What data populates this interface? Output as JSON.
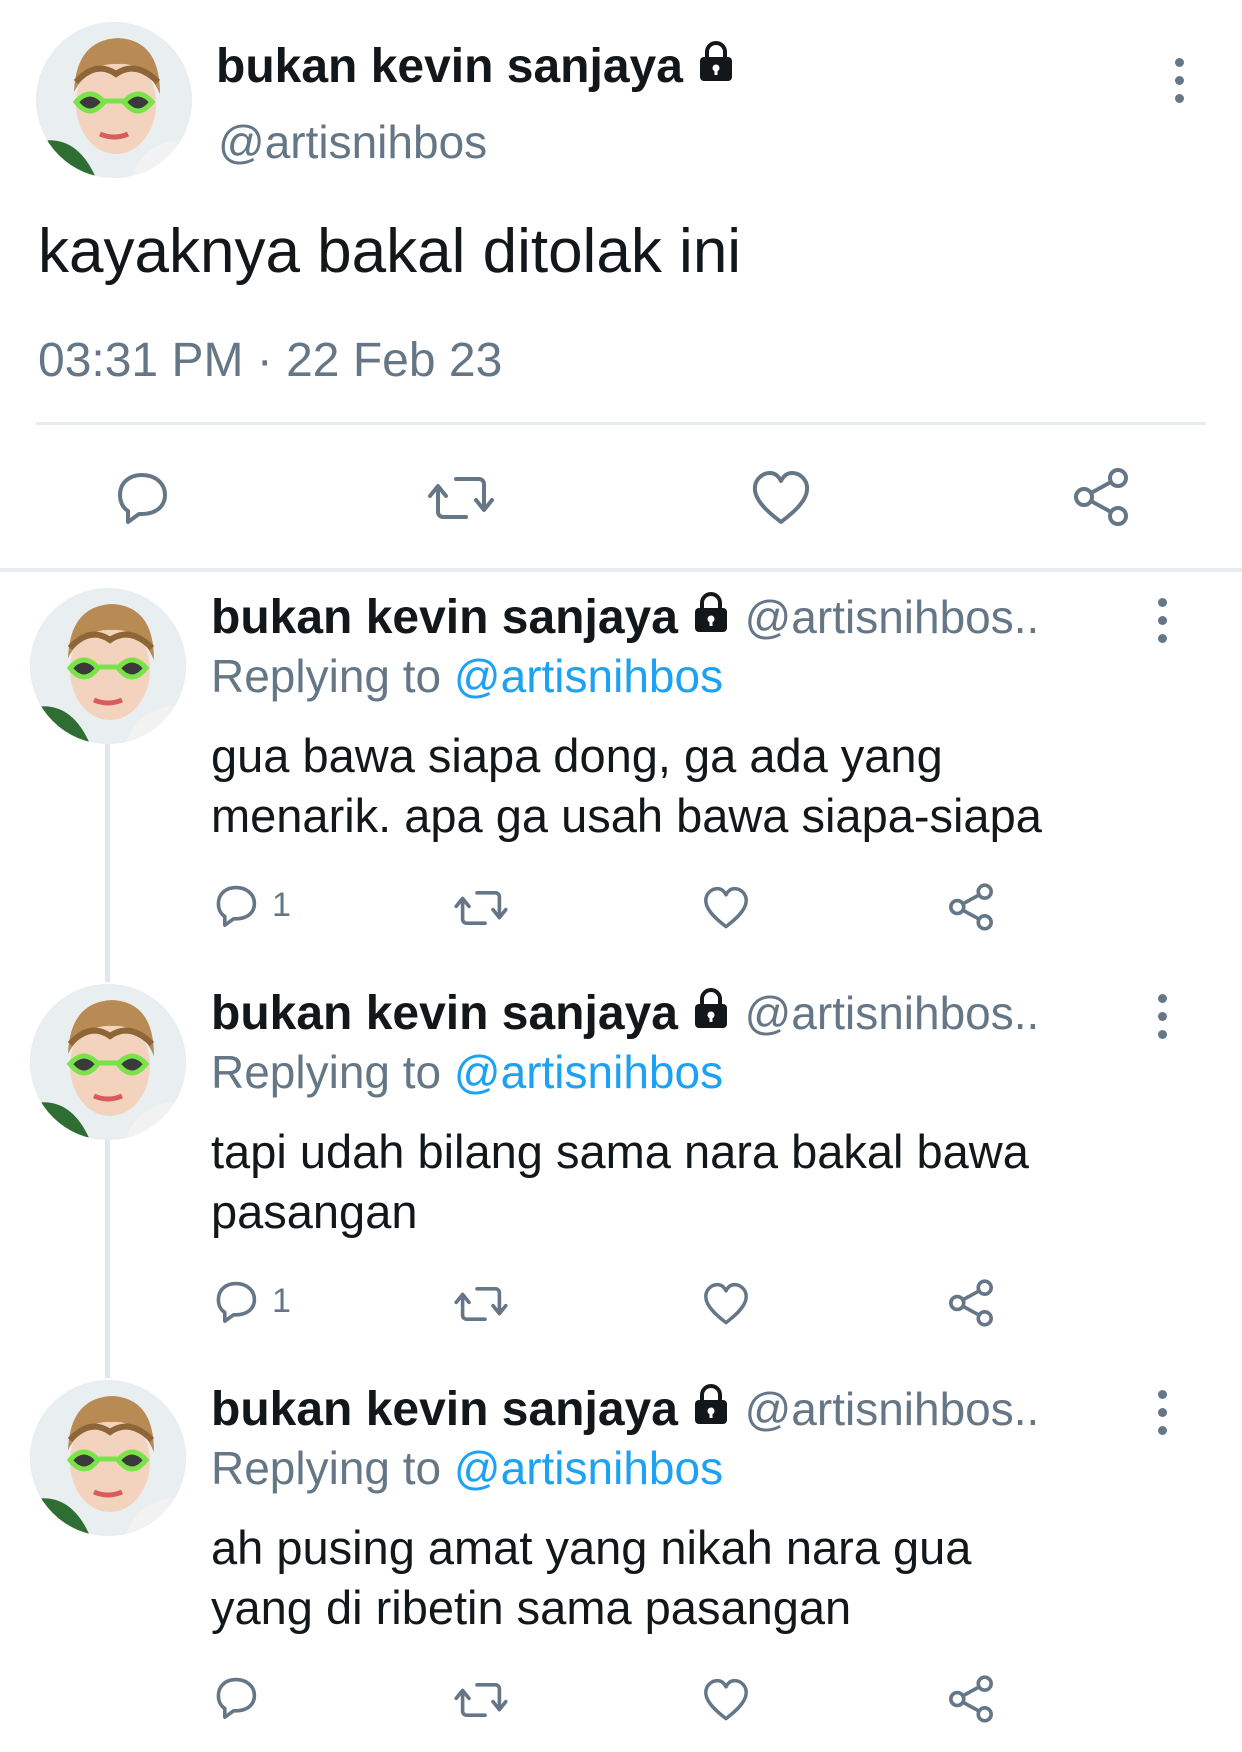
{
  "main_tweet": {
    "display_name": "bukan kevin sanjaya",
    "handle": "@artisnihbos",
    "text": "kayaknya bakal ditolak ini",
    "timestamp": "03:31 PM · 22 Feb 23",
    "icons": [
      "reply-icon",
      "retweet-icon",
      "like-icon",
      "share-icon"
    ]
  },
  "replies": [
    {
      "display_name": "bukan kevin sanjaya",
      "handle": "@artisnihbos..",
      "replying_prefix": "Replying to",
      "replying_to": "@artisnihbos",
      "line1": "gua bawa siapa dong, ga ada yang",
      "line2": "menarik. apa ga usah bawa siapa-siapa",
      "reply_count": "1"
    },
    {
      "display_name": "bukan kevin sanjaya",
      "handle": "@artisnihbos..",
      "replying_prefix": "Replying to",
      "replying_to": "@artisnihbos",
      "line1": "tapi udah bilang sama nara bakal bawa",
      "line2": "pasangan",
      "reply_count": "1"
    },
    {
      "display_name": "bukan kevin sanjaya",
      "handle": "@artisnihbos..",
      "replying_prefix": "Replying to",
      "replying_to": "@artisnihbos",
      "line1": "ah pusing amat yang nikah nara gua",
      "line2": "yang di ribetin sama pasangan",
      "reply_count": ""
    }
  ],
  "colors": {
    "text": "#14171a",
    "muted": "#657786",
    "link": "#1da1f2",
    "divider": "#e6ecf0"
  }
}
